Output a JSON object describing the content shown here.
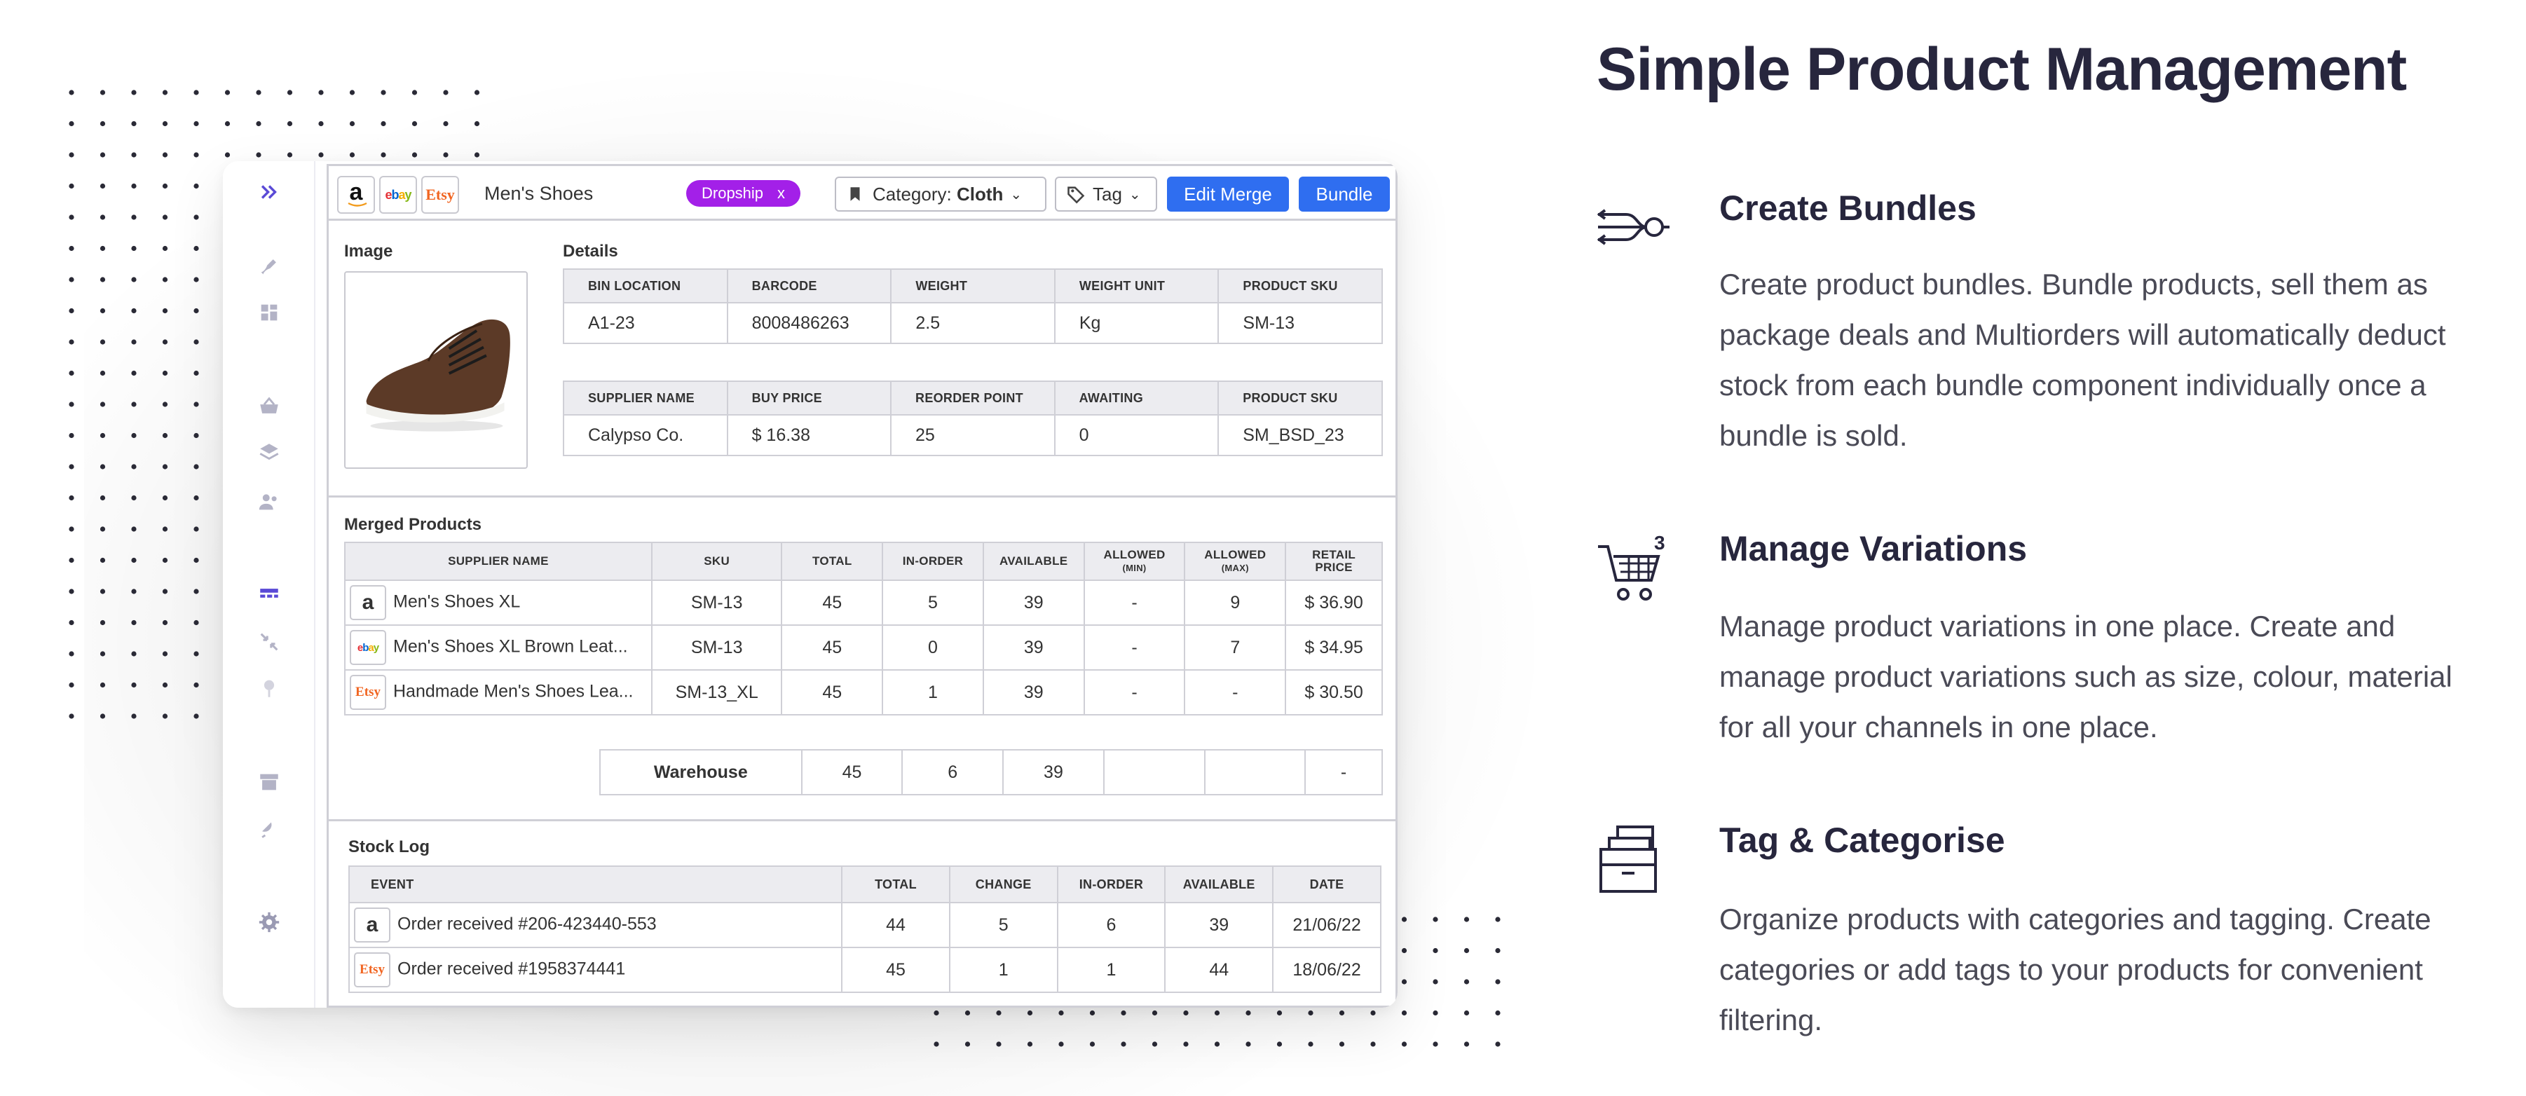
{
  "heading": "Simple Product Management",
  "features": [
    {
      "title": "Create Bundles",
      "desc": "Create product bundles. Bundle products, sell them as package deals and Multiorders will automatically deduct stock from each bundle component individually once a bundle is sold.",
      "icon": "bundle-icon"
    },
    {
      "title": "Manage Variations",
      "desc": "Manage product variations in one place. Create and manage product variations such as size, colour, material for all your channels in one place.",
      "icon": "cart-icon",
      "badge": "3"
    },
    {
      "title": "Tag & Categorise",
      "desc": "Organize products with categories and tagging. Create categories or add tags to your products for convenient filtering.",
      "icon": "boxes-icon"
    }
  ],
  "app": {
    "channels": [
      "a",
      "ebay",
      "Etsy"
    ],
    "product_title": "Men's Shoes",
    "dropship_label": "Dropship",
    "dropship_x": "x",
    "category_label": "Category:",
    "category_value": "Cloth",
    "tag_label": "Tag",
    "edit_merge_label": "Edit Merge",
    "bundle_label": "Bundle",
    "image_label": "Image",
    "details_label": "Details",
    "details1": {
      "headers": [
        "BIN LOCATION",
        "BARCODE",
        "WEIGHT",
        "WEIGHT UNIT",
        "PRODUCT SKU"
      ],
      "values": [
        "A1-23",
        "8008486263",
        "2.5",
        "Kg",
        "SM-13"
      ]
    },
    "details2": {
      "headers": [
        "SUPPLIER NAME",
        "BUY PRICE",
        "REORDER POINT",
        "AWAITING",
        "PRODUCT SKU"
      ],
      "values": [
        "Calypso Co.",
        "$ 16.38",
        "25",
        "0",
        "SM_BSD_23"
      ]
    },
    "merged_label": "Merged Products",
    "merged": {
      "headers": [
        "SUPPLIER NAME",
        "SKU",
        "TOTAL",
        "IN-ORDER",
        "AVAILABLE",
        "ALLOWED",
        "ALLOWED",
        "RETAIL"
      ],
      "subheaders": [
        "(MIN)",
        "(MAX)",
        "PRICE"
      ],
      "rows": [
        {
          "channel": "a",
          "name": "Men's Shoes XL",
          "sku": "SM-13",
          "total": "45",
          "inorder": "5",
          "available": "39",
          "min": "-",
          "max": "9",
          "price": "$ 36.90"
        },
        {
          "channel": "ebay",
          "name": "Men's Shoes XL Brown Leat...",
          "sku": "SM-13",
          "total": "45",
          "inorder": "0",
          "available": "39",
          "min": "-",
          "max": "7",
          "price": "$ 34.95"
        },
        {
          "channel": "Etsy",
          "name": "Handmade Men's Shoes Lea...",
          "sku": "SM-13_XL",
          "total": "45",
          "inorder": "1",
          "available": "39",
          "min": "-",
          "max": "-",
          "price": "$ 30.50"
        }
      ],
      "warehouse": {
        "label": "Warehouse",
        "total": "45",
        "inorder": "6",
        "available": "39",
        "price": "-"
      }
    },
    "stocklog_label": "Stock Log",
    "stocklog": {
      "headers": [
        "EVENT",
        "TOTAL",
        "CHANGE",
        "IN-ORDER",
        "AVAILABLE",
        "DATE"
      ],
      "rows": [
        {
          "channel": "a",
          "event": "Order received #206-423440-553",
          "total": "44",
          "change": "5",
          "inorder": "6",
          "available": "39",
          "date": "21/06/22"
        },
        {
          "channel": "Etsy",
          "event": "Order received #1958374441",
          "total": "45",
          "change": "1",
          "inorder": "1",
          "available": "44",
          "date": "18/06/22"
        }
      ]
    }
  },
  "colors": {
    "dropship": "#a320e8",
    "primary_button": "#2f6ef0",
    "heading": "#27263d",
    "sidebar_icon": "#5a4ad6"
  }
}
